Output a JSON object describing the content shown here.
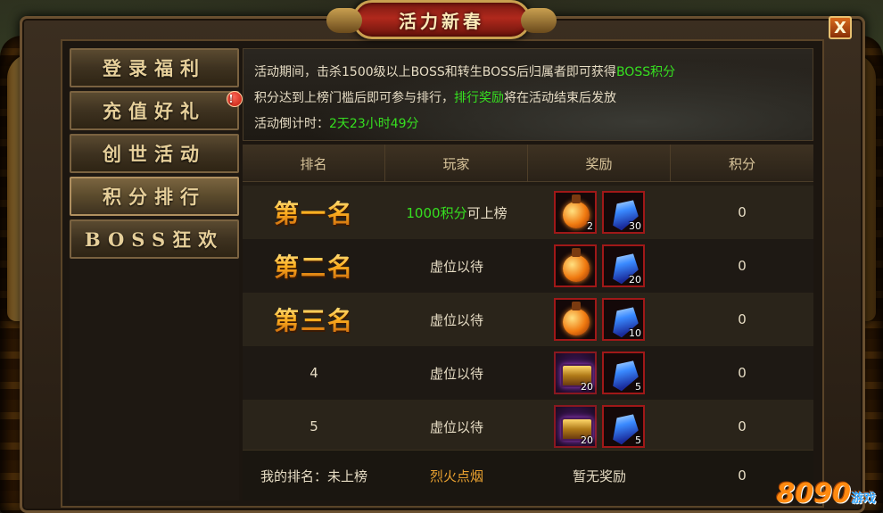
{
  "window": {
    "title": "活力新春",
    "close_label": "X"
  },
  "sidebar": {
    "items": [
      {
        "label": "登录福利",
        "active": false,
        "badge": ""
      },
      {
        "label": "充值好礼",
        "active": false,
        "badge": "!"
      },
      {
        "label": "创世活动",
        "active": false,
        "badge": ""
      },
      {
        "label": "积分排行",
        "active": true,
        "badge": ""
      },
      {
        "label": "BOSS狂欢",
        "active": false,
        "badge": ""
      }
    ]
  },
  "info": {
    "line1_prefix": "活动期间，击杀1500级以上BOSS和转生BOSS后归属者即可获得",
    "line1_highlight": "BOSS积分",
    "line2_prefix": "积分达到上榜门槛后即可参与排行，",
    "line2_highlight": "排行奖励",
    "line2_suffix": "将在活动结束后发放",
    "line3_prefix": "活动倒计时：",
    "line3_highlight": "2天23小时49分"
  },
  "table": {
    "headers": [
      "排名",
      "玩家",
      "奖励",
      "积分"
    ],
    "rows": [
      {
        "rank": "第一名",
        "player_highlight": "1000积分",
        "player_suffix": "可上榜",
        "rewards": [
          {
            "icon": "potion-icon",
            "count": "2"
          },
          {
            "icon": "crystal-icon",
            "count": "30"
          }
        ],
        "score": "0"
      },
      {
        "rank": "第二名",
        "player_highlight": "",
        "player_suffix": "虚位以待",
        "rewards": [
          {
            "icon": "potion-icon",
            "count": ""
          },
          {
            "icon": "crystal-icon",
            "count": "20"
          }
        ],
        "score": "0"
      },
      {
        "rank": "第三名",
        "player_highlight": "",
        "player_suffix": "虚位以待",
        "rewards": [
          {
            "icon": "potion-icon",
            "count": ""
          },
          {
            "icon": "crystal-icon",
            "count": "10"
          }
        ],
        "score": "0"
      },
      {
        "rank": "4",
        "player_highlight": "",
        "player_suffix": "虚位以待",
        "rewards": [
          {
            "icon": "chest-icon",
            "count": "20"
          },
          {
            "icon": "crystal-icon",
            "count": "5"
          }
        ],
        "score": "0"
      },
      {
        "rank": "5",
        "player_highlight": "",
        "player_suffix": "虚位以待",
        "rewards": [
          {
            "icon": "chest-icon",
            "count": "20"
          },
          {
            "icon": "crystal-icon",
            "count": "5"
          }
        ],
        "score": "0"
      }
    ],
    "footer": {
      "my_rank": "我的排名：未上榜",
      "player_name": "烈火点烟",
      "reward": "暂无奖励",
      "score": "0"
    }
  },
  "watermark": {
    "brand": "8090",
    "suffix": "游戏"
  },
  "colors": {
    "highlight_green": "#36e020",
    "rank_gold": "#ffb020",
    "player_amber": "#e8a030"
  }
}
